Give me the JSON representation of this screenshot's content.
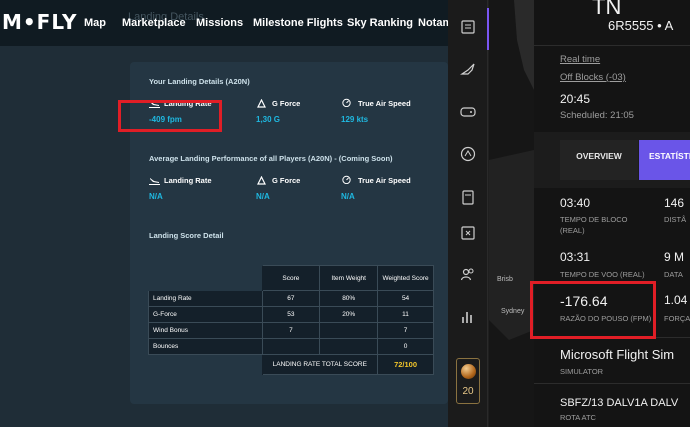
{
  "left_app": {
    "logo_text": "M•FLY",
    "ghost_title": "Landing Details",
    "nav": [
      "Map",
      "Marketplace",
      "Missions",
      "Milestone Flights",
      "Sky Ranking",
      "Notam"
    ],
    "your_landing": {
      "title": "Your Landing Details (A20N)",
      "metrics": [
        {
          "label": "Landing Rate",
          "value": "-409 fpm",
          "icon": "plane-landing-icon"
        },
        {
          "label": "G Force",
          "value": "1,30 G",
          "icon": "gauge-icon"
        },
        {
          "label": "True Air Speed",
          "value": "129 kts",
          "icon": "speedometer-icon"
        }
      ]
    },
    "average": {
      "title": "Average Landing Performance of all Players (A20N) - (Coming Soon)",
      "metrics": [
        {
          "label": "Landing Rate",
          "value": "N/A",
          "icon": "plane-landing-icon"
        },
        {
          "label": "G Force",
          "value": "N/A",
          "icon": "gauge-icon"
        },
        {
          "label": "True Air Speed",
          "value": "N/A",
          "icon": "speedometer-icon"
        }
      ]
    },
    "score": {
      "title": "Landing Score Detail",
      "headers": [
        "Score",
        "Item Weight",
        "Weighted Score"
      ],
      "rows": [
        {
          "label": "Landing Rate",
          "score": "67",
          "weight": "80%",
          "weighted": "54"
        },
        {
          "label": "G-Force",
          "score": "53",
          "weight": "20%",
          "weighted": "11"
        },
        {
          "label": "Wind Bonus",
          "score": "7",
          "weight": "",
          "weighted": "7"
        },
        {
          "label": "Bounces",
          "score": "",
          "weight": "",
          "weighted": "0"
        }
      ],
      "total_label": "LANDING RATE TOTAL SCORE",
      "total_value": "72/100"
    },
    "highlight_color": "#e01e26",
    "accent_color": "#1fb8e0"
  },
  "right_app": {
    "header_partial": "TN",
    "flight_line": "6R5555 • A",
    "map_labels": [
      "Brisb",
      "Sydney"
    ],
    "real_time_label": "Real time",
    "off_blocks": "Off Blocks (-03)",
    "time_value": "20:45",
    "scheduled": "Scheduled: 21:05",
    "tabs": [
      "OVERVIEW",
      "ESTATÍSTI"
    ],
    "stats": [
      {
        "value": "03:40",
        "label_line1": "TEMPO DE BLOCO",
        "label_line2": "(REAL)"
      },
      {
        "value": "146",
        "label_line1": "DISTÂ",
        "label_line2": ""
      },
      {
        "value": "03:31",
        "label_line1": "TEMPO DE VOO (REAL)",
        "label_line2": ""
      },
      {
        "value": "9 M",
        "label_line1": "DATA",
        "label_line2": ""
      },
      {
        "value": "-176.64",
        "label_line1": "RAZÃO DO POUSO (FPM)",
        "label_line2": ""
      },
      {
        "value": "1.04",
        "label_line1": "FORÇA",
        "label_line2": ""
      }
    ],
    "simulator_value": "Microsoft Flight Sim",
    "simulator_label": "SIMULATOR",
    "route_value": "SBFZ/13 DALV1A DALV",
    "route_label": "ROTA ATC",
    "avatar_level": "20",
    "accent_purple": "#6a55e8"
  }
}
